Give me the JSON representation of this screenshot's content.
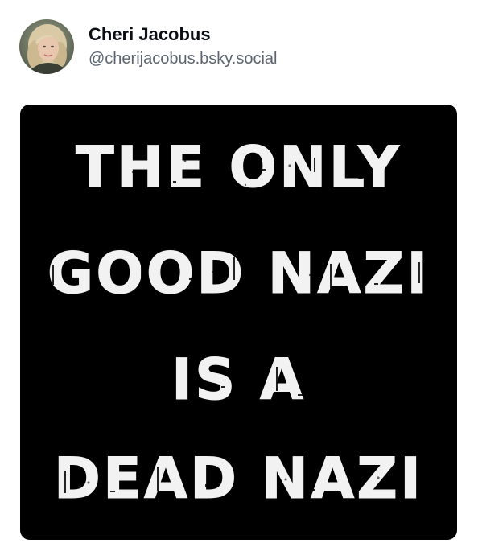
{
  "post": {
    "author": {
      "display_name": "Cheri Jacobus",
      "handle": "@cherijacobus.bsky.social",
      "avatar_icon": "profile-photo"
    },
    "image": {
      "background": "#000000",
      "text_color": "#f2f2f2",
      "lines": [
        "THE ONLY",
        "GOOD NAZI",
        "IS A",
        "DEAD NAZI"
      ]
    }
  }
}
